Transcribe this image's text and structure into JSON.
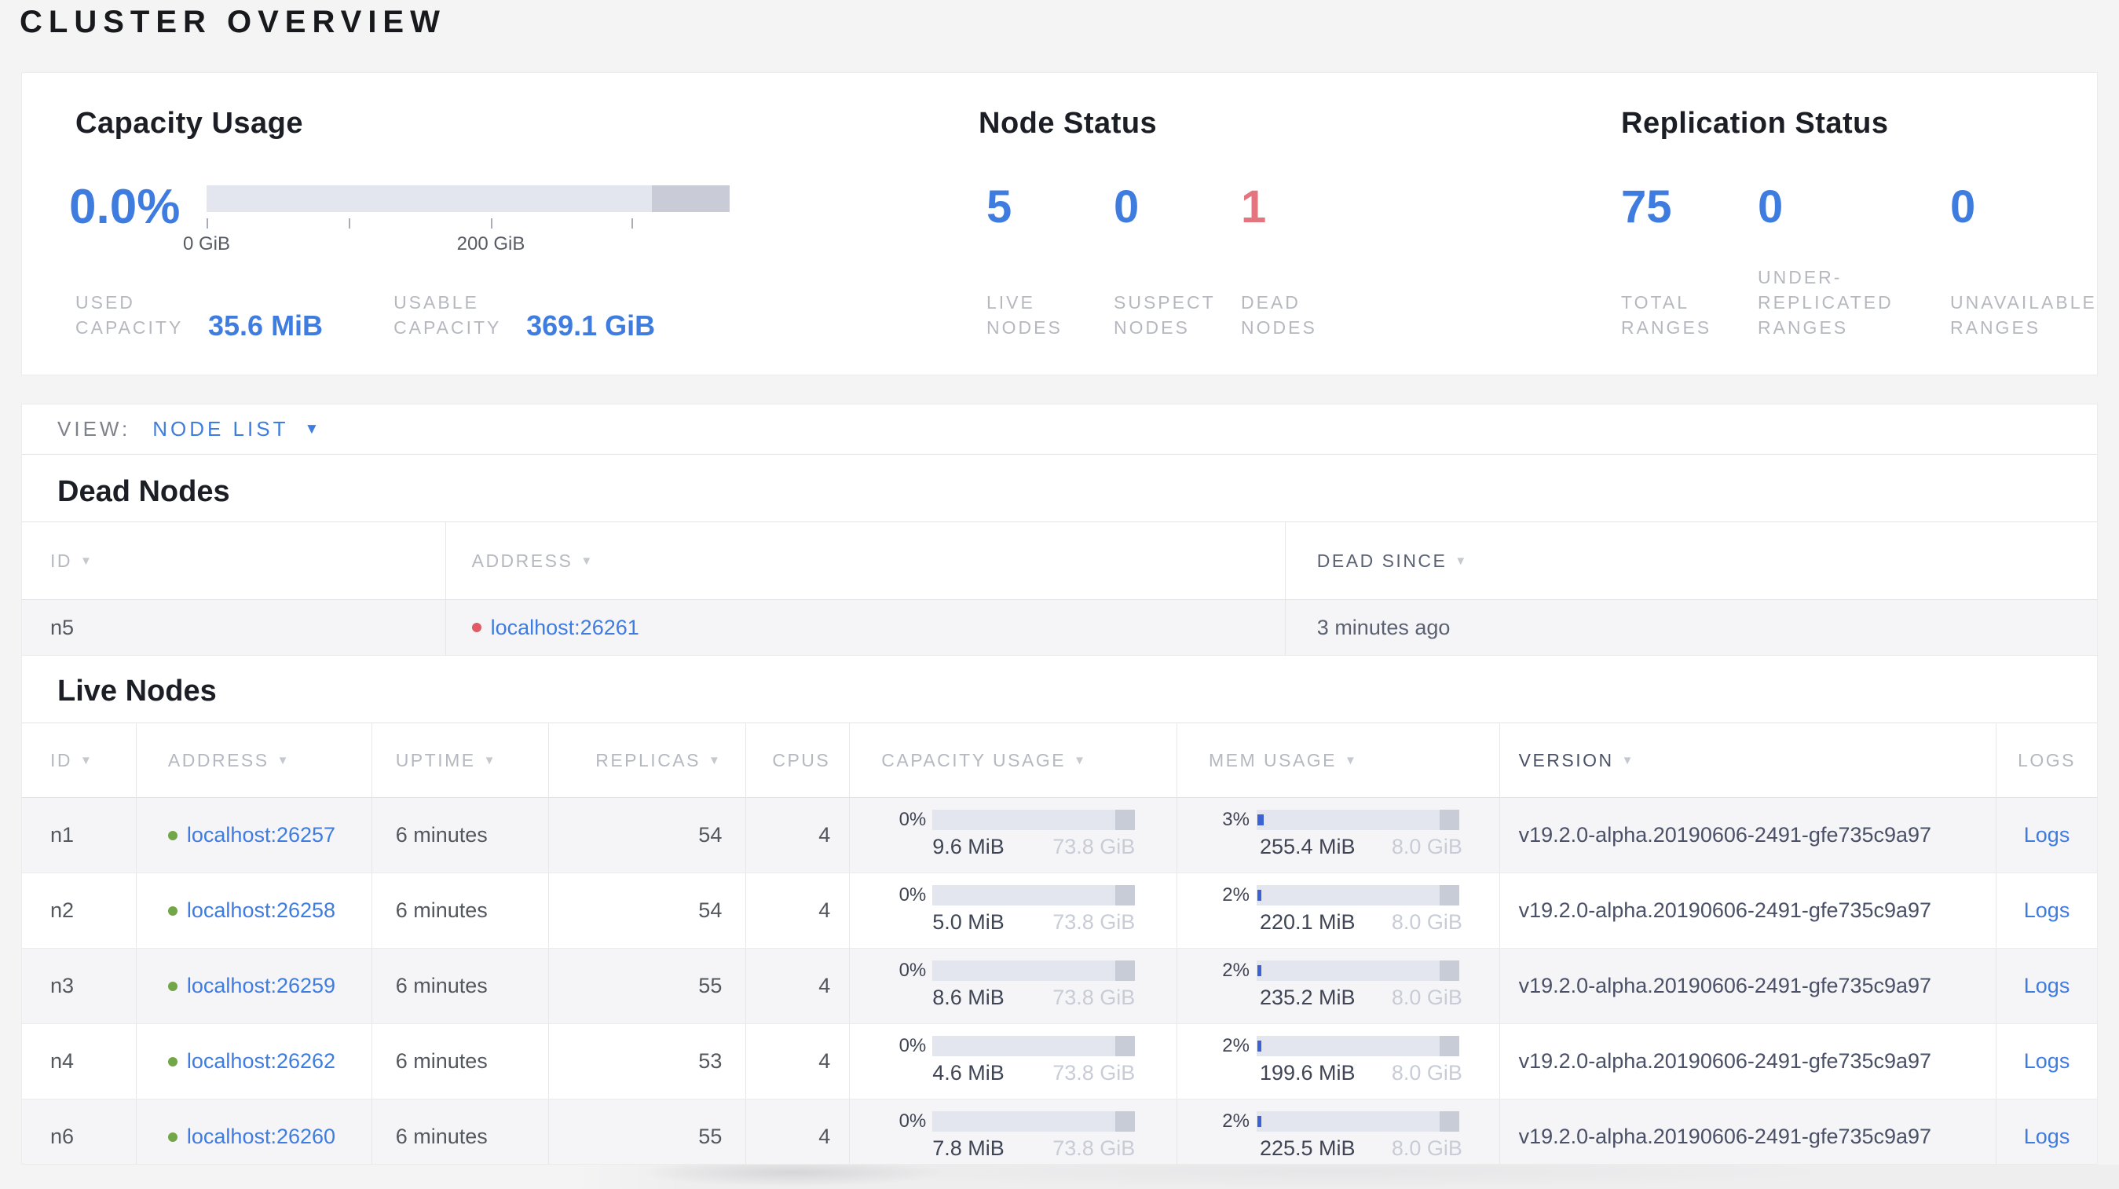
{
  "colors": {
    "accent_blue": "#3e7ce0",
    "danger_red": "#e4757f",
    "live_dot_green": "#73a648",
    "dead_dot_red": "#e05b63",
    "bar_track": "#e4e6ef",
    "bar_other_segment": "#c8ccd6",
    "bar_used_blue": "#3c63d2"
  },
  "page": {
    "title": "CLUSTER OVERVIEW"
  },
  "overview": {
    "capacity": {
      "heading": "Capacity Usage",
      "percent": "0.0%",
      "percent_num": 0,
      "tick_labels": [
        "0 GiB",
        "200 GiB"
      ],
      "stats": [
        {
          "label": "USED CAPACITY",
          "value": "35.6 MiB"
        },
        {
          "label": "USABLE CAPACITY",
          "value": "369.1 GiB"
        }
      ]
    },
    "node_status": {
      "heading": "Node Status",
      "stats": [
        {
          "value": "5",
          "label": "LIVE NODES",
          "status": "normal"
        },
        {
          "value": "0",
          "label": "SUSPECT NODES",
          "status": "normal"
        },
        {
          "value": "1",
          "label": "DEAD NODES",
          "status": "danger"
        }
      ]
    },
    "replication": {
      "heading": "Replication Status",
      "stats": [
        {
          "value": "75",
          "label": "TOTAL RANGES",
          "status": "normal"
        },
        {
          "value": "0",
          "label": "UNDER-REPLICATED RANGES",
          "status": "normal"
        },
        {
          "value": "0",
          "label": "UNAVAILABLE RANGES",
          "status": "normal"
        }
      ]
    }
  },
  "view_bar": {
    "label": "VIEW:",
    "selected": "NODE LIST"
  },
  "dead_nodes": {
    "heading": "Dead Nodes",
    "columns": [
      {
        "label": "ID",
        "sortable": true
      },
      {
        "label": "ADDRESS",
        "sortable": true
      },
      {
        "label": "DEAD SINCE",
        "sortable": true
      }
    ],
    "rows": [
      {
        "id": "n5",
        "address": "localhost:26261",
        "dead_since": "3 minutes ago"
      }
    ]
  },
  "live_nodes": {
    "heading": "Live Nodes",
    "logs_label": "Logs",
    "columns": [
      {
        "label": "ID",
        "sortable": true
      },
      {
        "label": "ADDRESS",
        "sortable": true
      },
      {
        "label": "UPTIME",
        "sortable": true
      },
      {
        "label": "REPLICAS",
        "sortable": true
      },
      {
        "label": "CPUS",
        "sortable": false
      },
      {
        "label": "CAPACITY USAGE",
        "sortable": true
      },
      {
        "label": "MEM USAGE",
        "sortable": true
      },
      {
        "label": "VERSION",
        "sortable": true
      },
      {
        "label": "LOGS",
        "sortable": false
      }
    ],
    "rows": [
      {
        "id": "n1",
        "address": "localhost:26257",
        "uptime": "6 minutes",
        "replicas": "54",
        "cpus": "4",
        "capacity": {
          "pct": "0%",
          "pct_num": 0,
          "used": "9.6 MiB",
          "total": "73.8 GiB"
        },
        "mem": {
          "pct": "3%",
          "pct_num": 3,
          "used": "255.4 MiB",
          "total": "8.0 GiB"
        },
        "version": "v19.2.0-alpha.20190606-2491-gfe735c9a97"
      },
      {
        "id": "n2",
        "address": "localhost:26258",
        "uptime": "6 minutes",
        "replicas": "54",
        "cpus": "4",
        "capacity": {
          "pct": "0%",
          "pct_num": 0,
          "used": "5.0 MiB",
          "total": "73.8 GiB"
        },
        "mem": {
          "pct": "2%",
          "pct_num": 2,
          "used": "220.1 MiB",
          "total": "8.0 GiB"
        },
        "version": "v19.2.0-alpha.20190606-2491-gfe735c9a97"
      },
      {
        "id": "n3",
        "address": "localhost:26259",
        "uptime": "6 minutes",
        "replicas": "55",
        "cpus": "4",
        "capacity": {
          "pct": "0%",
          "pct_num": 0,
          "used": "8.6 MiB",
          "total": "73.8 GiB"
        },
        "mem": {
          "pct": "2%",
          "pct_num": 2,
          "used": "235.2 MiB",
          "total": "8.0 GiB"
        },
        "version": "v19.2.0-alpha.20190606-2491-gfe735c9a97"
      },
      {
        "id": "n4",
        "address": "localhost:26262",
        "uptime": "6 minutes",
        "replicas": "53",
        "cpus": "4",
        "capacity": {
          "pct": "0%",
          "pct_num": 0,
          "used": "4.6 MiB",
          "total": "73.8 GiB"
        },
        "mem": {
          "pct": "2%",
          "pct_num": 2,
          "used": "199.6 MiB",
          "total": "8.0 GiB"
        },
        "version": "v19.2.0-alpha.20190606-2491-gfe735c9a97"
      },
      {
        "id": "n6",
        "address": "localhost:26260",
        "uptime": "6 minutes",
        "replicas": "55",
        "cpus": "4",
        "capacity": {
          "pct": "0%",
          "pct_num": 0,
          "used": "7.8 MiB",
          "total": "73.8 GiB"
        },
        "mem": {
          "pct": "2%",
          "pct_num": 2,
          "used": "225.5 MiB",
          "total": "8.0 GiB"
        },
        "version": "v19.2.0-alpha.20190606-2491-gfe735c9a97"
      }
    ]
  }
}
